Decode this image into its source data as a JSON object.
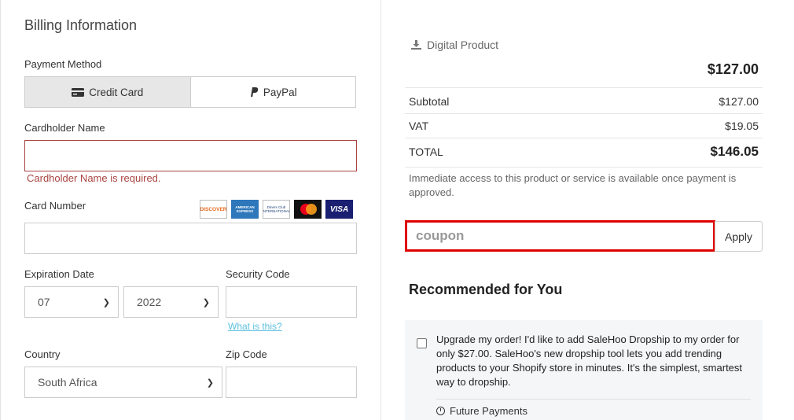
{
  "billing": {
    "title": "Billing Information",
    "payment_method_label": "Payment Method",
    "tabs": [
      {
        "label": "Credit Card",
        "icon": "credit-card-icon",
        "active": true
      },
      {
        "label": "PayPal",
        "icon": "paypal-icon",
        "active": false
      }
    ],
    "cardholder_label": "Cardholder Name",
    "cardholder_value": "",
    "cardholder_error": "Cardholder Name is required.",
    "card_number_label": "Card Number",
    "card_number_value": "",
    "card_logos": [
      "DISCOVER",
      "AMERICAN EXPRESS",
      "Diners Club INTERNATIONAL",
      "mastercard",
      "VISA"
    ],
    "expiration_label": "Expiration Date",
    "exp_month": "07",
    "exp_year": "2022",
    "security_label": "Security Code",
    "security_value": "",
    "what_is_this": "What is this?",
    "country_label": "Country",
    "country_value": "South Africa",
    "zip_label": "Zip Code",
    "zip_value": ""
  },
  "summary": {
    "product_type": "Digital Product",
    "price": "$127.00",
    "subtotal_label": "Subtotal",
    "subtotal_value": "$127.00",
    "vat_label": "VAT",
    "vat_value": "$19.05",
    "total_label": "TOTAL",
    "total_value": "$146.05",
    "access_note": "Immediate access to this product or service is available once payment is approved.",
    "coupon_placeholder": "coupon",
    "apply_label": "Apply"
  },
  "recommended": {
    "title": "Recommended for You",
    "offer_text": "Upgrade my order! I'd like to add SaleHoo Dropship to my order for only $27.00. SaleHoo's new dropship tool lets you add trending products to your Shopify store in minutes. It's the simplest, smartest way to dropship.",
    "offer_checked": false,
    "future_payments": "Future Payments"
  },
  "colors": {
    "error": "#a94442",
    "link": "#5bc0de",
    "highlight": "#e00000"
  }
}
